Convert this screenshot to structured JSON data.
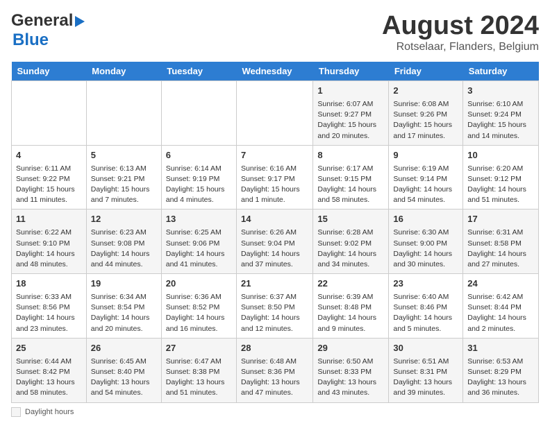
{
  "header": {
    "logo_line1": "General",
    "logo_line2": "Blue",
    "month": "August 2024",
    "location": "Rotselaar, Flanders, Belgium"
  },
  "days_of_week": [
    "Sunday",
    "Monday",
    "Tuesday",
    "Wednesday",
    "Thursday",
    "Friday",
    "Saturday"
  ],
  "footer": {
    "daylight_label": "Daylight hours"
  },
  "weeks": [
    [
      {
        "day": "",
        "content": ""
      },
      {
        "day": "",
        "content": ""
      },
      {
        "day": "",
        "content": ""
      },
      {
        "day": "",
        "content": ""
      },
      {
        "day": "1",
        "content": "Sunrise: 6:07 AM\nSunset: 9:27 PM\nDaylight: 15 hours and 20 minutes."
      },
      {
        "day": "2",
        "content": "Sunrise: 6:08 AM\nSunset: 9:26 PM\nDaylight: 15 hours and 17 minutes."
      },
      {
        "day": "3",
        "content": "Sunrise: 6:10 AM\nSunset: 9:24 PM\nDaylight: 15 hours and 14 minutes."
      }
    ],
    [
      {
        "day": "4",
        "content": "Sunrise: 6:11 AM\nSunset: 9:22 PM\nDaylight: 15 hours and 11 minutes."
      },
      {
        "day": "5",
        "content": "Sunrise: 6:13 AM\nSunset: 9:21 PM\nDaylight: 15 hours and 7 minutes."
      },
      {
        "day": "6",
        "content": "Sunrise: 6:14 AM\nSunset: 9:19 PM\nDaylight: 15 hours and 4 minutes."
      },
      {
        "day": "7",
        "content": "Sunrise: 6:16 AM\nSunset: 9:17 PM\nDaylight: 15 hours and 1 minute."
      },
      {
        "day": "8",
        "content": "Sunrise: 6:17 AM\nSunset: 9:15 PM\nDaylight: 14 hours and 58 minutes."
      },
      {
        "day": "9",
        "content": "Sunrise: 6:19 AM\nSunset: 9:14 PM\nDaylight: 14 hours and 54 minutes."
      },
      {
        "day": "10",
        "content": "Sunrise: 6:20 AM\nSunset: 9:12 PM\nDaylight: 14 hours and 51 minutes."
      }
    ],
    [
      {
        "day": "11",
        "content": "Sunrise: 6:22 AM\nSunset: 9:10 PM\nDaylight: 14 hours and 48 minutes."
      },
      {
        "day": "12",
        "content": "Sunrise: 6:23 AM\nSunset: 9:08 PM\nDaylight: 14 hours and 44 minutes."
      },
      {
        "day": "13",
        "content": "Sunrise: 6:25 AM\nSunset: 9:06 PM\nDaylight: 14 hours and 41 minutes."
      },
      {
        "day": "14",
        "content": "Sunrise: 6:26 AM\nSunset: 9:04 PM\nDaylight: 14 hours and 37 minutes."
      },
      {
        "day": "15",
        "content": "Sunrise: 6:28 AM\nSunset: 9:02 PM\nDaylight: 14 hours and 34 minutes."
      },
      {
        "day": "16",
        "content": "Sunrise: 6:30 AM\nSunset: 9:00 PM\nDaylight: 14 hours and 30 minutes."
      },
      {
        "day": "17",
        "content": "Sunrise: 6:31 AM\nSunset: 8:58 PM\nDaylight: 14 hours and 27 minutes."
      }
    ],
    [
      {
        "day": "18",
        "content": "Sunrise: 6:33 AM\nSunset: 8:56 PM\nDaylight: 14 hours and 23 minutes."
      },
      {
        "day": "19",
        "content": "Sunrise: 6:34 AM\nSunset: 8:54 PM\nDaylight: 14 hours and 20 minutes."
      },
      {
        "day": "20",
        "content": "Sunrise: 6:36 AM\nSunset: 8:52 PM\nDaylight: 14 hours and 16 minutes."
      },
      {
        "day": "21",
        "content": "Sunrise: 6:37 AM\nSunset: 8:50 PM\nDaylight: 14 hours and 12 minutes."
      },
      {
        "day": "22",
        "content": "Sunrise: 6:39 AM\nSunset: 8:48 PM\nDaylight: 14 hours and 9 minutes."
      },
      {
        "day": "23",
        "content": "Sunrise: 6:40 AM\nSunset: 8:46 PM\nDaylight: 14 hours and 5 minutes."
      },
      {
        "day": "24",
        "content": "Sunrise: 6:42 AM\nSunset: 8:44 PM\nDaylight: 14 hours and 2 minutes."
      }
    ],
    [
      {
        "day": "25",
        "content": "Sunrise: 6:44 AM\nSunset: 8:42 PM\nDaylight: 13 hours and 58 minutes."
      },
      {
        "day": "26",
        "content": "Sunrise: 6:45 AM\nSunset: 8:40 PM\nDaylight: 13 hours and 54 minutes."
      },
      {
        "day": "27",
        "content": "Sunrise: 6:47 AM\nSunset: 8:38 PM\nDaylight: 13 hours and 51 minutes."
      },
      {
        "day": "28",
        "content": "Sunrise: 6:48 AM\nSunset: 8:36 PM\nDaylight: 13 hours and 47 minutes."
      },
      {
        "day": "29",
        "content": "Sunrise: 6:50 AM\nSunset: 8:33 PM\nDaylight: 13 hours and 43 minutes."
      },
      {
        "day": "30",
        "content": "Sunrise: 6:51 AM\nSunset: 8:31 PM\nDaylight: 13 hours and 39 minutes."
      },
      {
        "day": "31",
        "content": "Sunrise: 6:53 AM\nSunset: 8:29 PM\nDaylight: 13 hours and 36 minutes."
      }
    ]
  ]
}
